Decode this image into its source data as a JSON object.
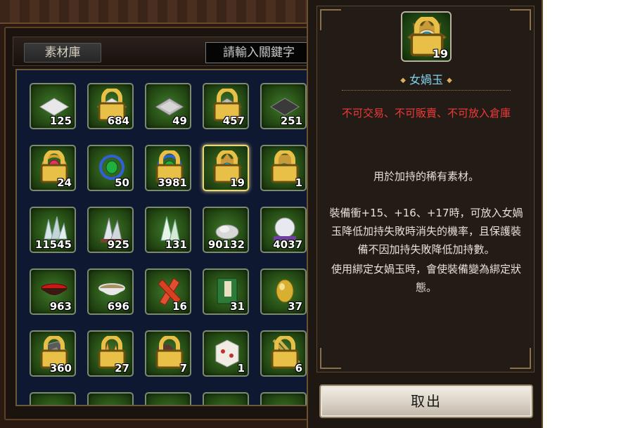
{
  "inventory": {
    "tab_label": "素材庫",
    "search_placeholder": "請輸入關鍵字",
    "slots": [
      {
        "qty": "125",
        "icon": "white-cloth-icon",
        "locked": false
      },
      {
        "qty": "684",
        "icon": "white-cloth-icon",
        "locked": true
      },
      {
        "qty": "49",
        "icon": "grey-plate-icon",
        "locked": false
      },
      {
        "qty": "457",
        "icon": "grey-plate-icon",
        "locked": true
      },
      {
        "qty": "251",
        "icon": "dark-plate-icon",
        "locked": false
      },
      {
        "qty": "24",
        "icon": "red-gem-amulet-icon",
        "locked": true
      },
      {
        "qty": "50",
        "icon": "green-gem-amulet-icon",
        "locked": false
      },
      {
        "qty": "3981",
        "icon": "green-gem-amulet-icon",
        "locked": true
      },
      {
        "qty": "19",
        "icon": "nuwa-jade-icon",
        "locked": true,
        "selected": true
      },
      {
        "qty": "1",
        "icon": "talisman-icon",
        "locked": true
      },
      {
        "qty": "11545",
        "icon": "crystal-shards-icon",
        "locked": false
      },
      {
        "qty": "925",
        "icon": "crystal-cluster-icon",
        "locked": false
      },
      {
        "qty": "131",
        "icon": "green-crystal-icon",
        "locked": false
      },
      {
        "qty": "90132",
        "icon": "silver-ore-icon",
        "locked": false
      },
      {
        "qty": "4037",
        "icon": "pearl-orb-icon",
        "locked": false
      },
      {
        "qty": "963",
        "icon": "red-bowl-icon",
        "locked": false
      },
      {
        "qty": "696",
        "icon": "porcelain-bowl-icon",
        "locked": false
      },
      {
        "qty": "16",
        "icon": "red-crystal-icon",
        "locked": false
      },
      {
        "qty": "31",
        "icon": "green-book-icon",
        "locked": false
      },
      {
        "qty": "37",
        "icon": "gold-egg-icon",
        "locked": false
      },
      {
        "qty": "360",
        "icon": "dark-ore-icon",
        "locked": true
      },
      {
        "qty": "27",
        "icon": "amber-crystal-icon",
        "locked": true
      },
      {
        "qty": "7",
        "icon": "rice-bowl-icon",
        "locked": true
      },
      {
        "qty": "1",
        "icon": "paper-package-icon",
        "locked": false
      },
      {
        "qty": "6",
        "icon": "chopsticks-icon",
        "locked": true
      }
    ]
  },
  "tooltip": {
    "item_name": "女媧玉",
    "item_qty": "19",
    "item_icon": "nuwa-jade-icon",
    "restriction": "不可交易、不可販賣、不可放入倉庫",
    "description_line1": "用於加持的稀有素材。",
    "description_body": "裝備衝+15、+16、+17時，可放入女媧玉降低加持失敗時消失的機率，且保護裝備不因加持失敗降低加持數。",
    "description_bind": "使用綁定女媧玉時，會使裝備變為綁定狀態。",
    "cancel_label": "取出"
  },
  "colors": {
    "restriction": "#ef3a3a",
    "item_name": "#7fd4ef",
    "slot_green": "#285016",
    "selected_border": "#e8d878"
  }
}
